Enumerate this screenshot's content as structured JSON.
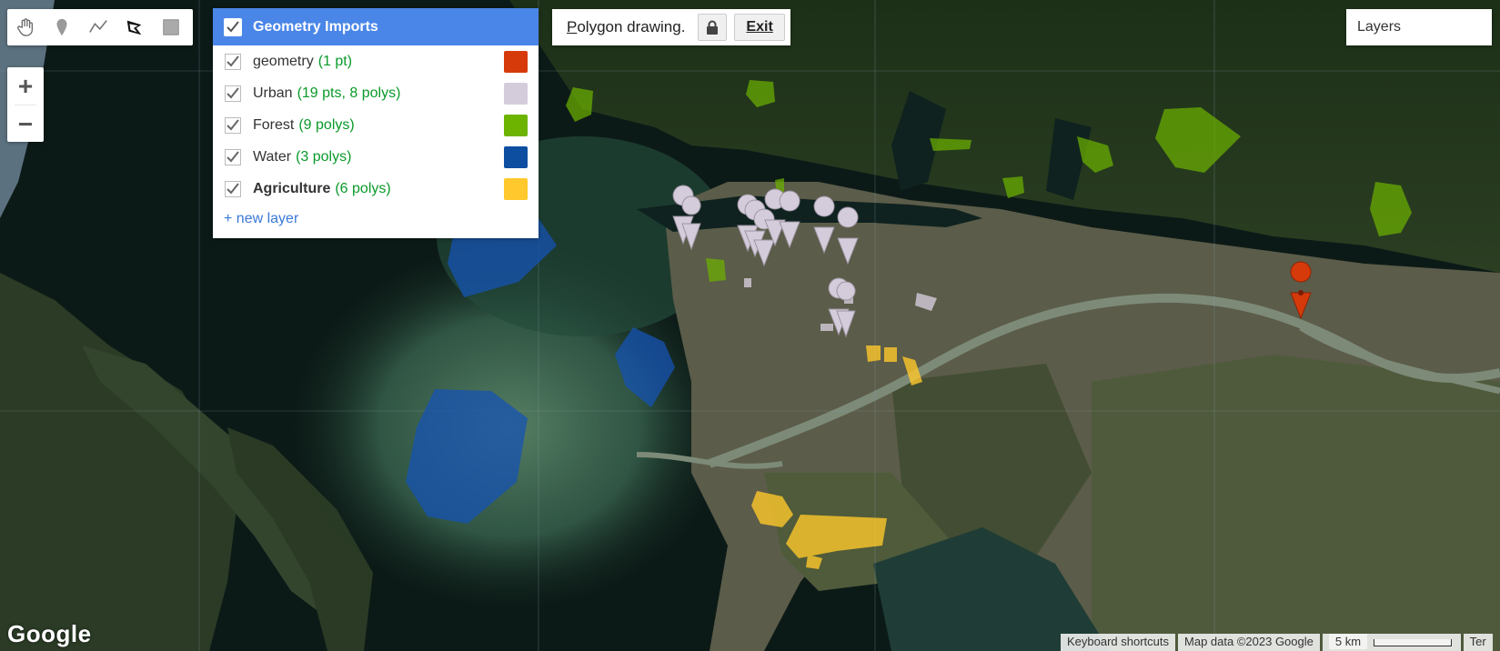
{
  "toolbar": {
    "tools": [
      {
        "icon": "hand-icon",
        "label": ""
      },
      {
        "icon": "marker-icon",
        "label": ""
      },
      {
        "icon": "line-icon",
        "label": ""
      },
      {
        "icon": "polygon-icon",
        "label": ""
      },
      {
        "icon": "rectangle-icon",
        "label": ""
      }
    ]
  },
  "zoom": {
    "in": "+",
    "out": "−"
  },
  "imports": {
    "title": "Geometry Imports",
    "layers": [
      {
        "name": "geometry",
        "count": "(1 pt)",
        "color": "#d63a0b",
        "bold": false
      },
      {
        "name": "Urban",
        "count": "(19 pts, 8 polys)",
        "color": "#d5ccdb",
        "bold": false
      },
      {
        "name": "Forest",
        "count": "(9 polys)",
        "color": "#6db400",
        "bold": false
      },
      {
        "name": "Water",
        "count": "(3 polys)",
        "color": "#0e4ea1",
        "bold": false
      },
      {
        "name": "Agriculture",
        "count": "(6 polys)",
        "color": "#ffc82c",
        "bold": true
      }
    ],
    "new_layer": "+ new layer"
  },
  "drawing": {
    "prefix": "P",
    "text": "olygon drawing.",
    "exit_label": "Exit"
  },
  "layers_button": "Layers",
  "brand": "Google",
  "attribution": {
    "keyboard": "Keyboard shortcuts",
    "mapdata": "Map data ©2023 Google",
    "scale": "5 km",
    "terms": "Ter"
  },
  "colors": {
    "accent": "#4a86e8",
    "count_text": "#0a9a2a"
  }
}
